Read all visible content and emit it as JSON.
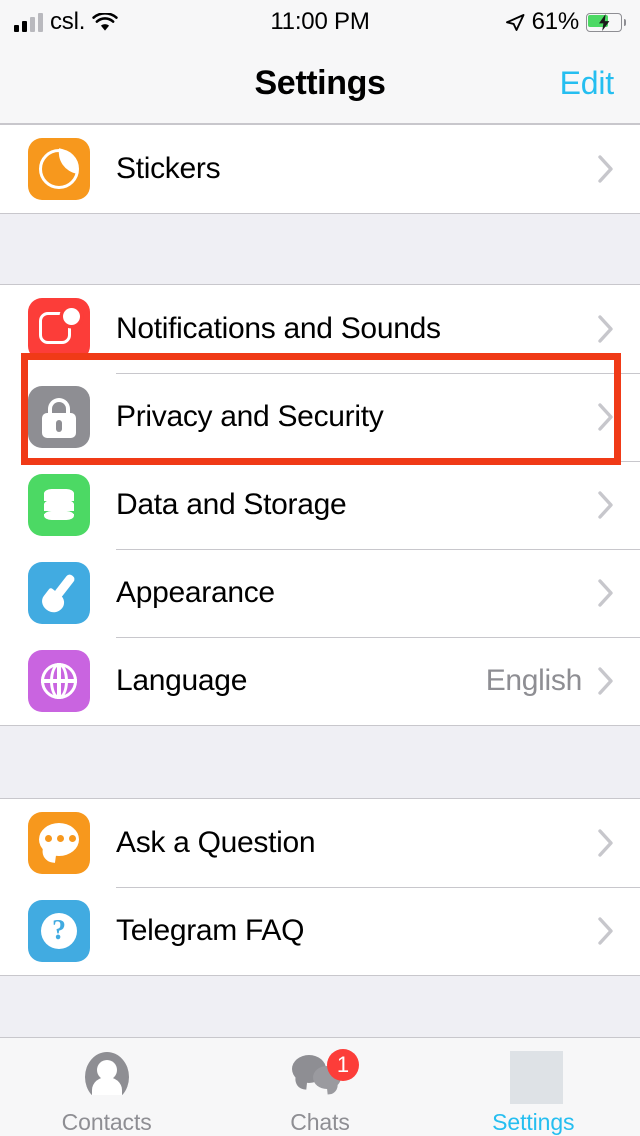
{
  "status_bar": {
    "carrier": "csl.",
    "time": "11:00 PM",
    "battery_percent": "61%",
    "signal_icon": "cellular-signal-icon",
    "wifi_icon": "wifi-icon",
    "location_icon": "location-arrow-icon",
    "battery_icon": "battery-charging-icon"
  },
  "nav": {
    "title": "Settings",
    "edit_label": "Edit",
    "edit_color": "#25BEF0"
  },
  "sections": [
    {
      "rows": [
        {
          "label": "Stickers",
          "value": "",
          "icon": "stickers-icon",
          "icon_color": "#F7981D"
        }
      ]
    },
    {
      "rows": [
        {
          "label": "Notifications and Sounds",
          "value": "",
          "icon": "notifications-icon",
          "icon_color": "#FC3D39"
        },
        {
          "label": "Privacy and Security",
          "value": "",
          "icon": "lock-icon",
          "icon_color": "#8E8E93"
        },
        {
          "label": "Data and Storage",
          "value": "",
          "icon": "database-icon",
          "icon_color": "#4CD964"
        },
        {
          "label": "Appearance",
          "value": "",
          "icon": "paintbrush-icon",
          "icon_color": "#41ABE1"
        },
        {
          "label": "Language",
          "value": "English",
          "icon": "globe-icon",
          "icon_color": "#C964E0"
        }
      ]
    },
    {
      "rows": [
        {
          "label": "Ask a Question",
          "value": "",
          "icon": "chat-bubble-icon",
          "icon_color": "#F7981D"
        },
        {
          "label": "Telegram FAQ",
          "value": "",
          "icon": "question-mark-icon",
          "icon_color": "#41ABE1"
        }
      ]
    }
  ],
  "annotation": {
    "target": "Privacy and Security",
    "color": "#F03A17"
  },
  "tab_bar": {
    "tabs": [
      {
        "label": "Contacts",
        "icon": "person-icon",
        "active": false,
        "badge": ""
      },
      {
        "label": "Chats",
        "icon": "chats-icon",
        "active": false,
        "badge": "1"
      },
      {
        "label": "Settings",
        "icon": "settings-icon",
        "active": true,
        "badge": ""
      }
    ],
    "active_color": "#25BEF0",
    "inactive_color": "#8E8E93",
    "badge_color": "#FC3D39"
  }
}
